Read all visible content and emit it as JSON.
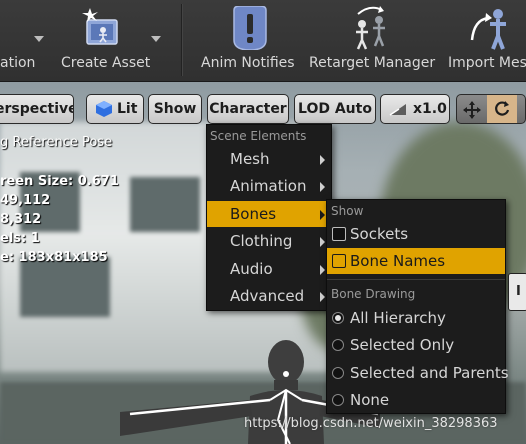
{
  "toolbar": {
    "items": [
      {
        "label": "ation",
        "icon": "animation-icon",
        "has_dropdown": true
      },
      {
        "label": "Create Asset",
        "icon": "create-asset-icon",
        "has_dropdown": true
      },
      {
        "label": "Anim Notifies",
        "icon": "anim-notifies-icon",
        "has_dropdown": false
      },
      {
        "label": "Retarget Manager",
        "icon": "retarget-manager-icon",
        "has_dropdown": false
      },
      {
        "label": "Import Mesh",
        "icon": "import-mesh-icon",
        "has_dropdown": false
      }
    ]
  },
  "viewport_toolbar": {
    "perspective": "erspective",
    "lit": "Lit",
    "show": "Show",
    "character": "Character",
    "lod": "LOD Auto",
    "speed": "x1.0",
    "icons": [
      "view-mode-icon",
      "translate-gizmo-icon",
      "rotate-gizmo-icon"
    ]
  },
  "stats": [
    "g Reference Pose",
    "reen Size: 0.671",
    "49,112",
    "8,312",
    "els: 1",
    "e: 183x81x185"
  ],
  "character_menu": {
    "header": "Scene Elements",
    "items": [
      {
        "label": "Mesh",
        "highlighted": false
      },
      {
        "label": "Animation",
        "highlighted": false
      },
      {
        "label": "Bones",
        "highlighted": true
      },
      {
        "label": "Clothing",
        "highlighted": false
      },
      {
        "label": "Audio",
        "highlighted": false
      },
      {
        "label": "Advanced",
        "highlighted": false
      }
    ]
  },
  "bones_menu": {
    "show_header": "Show",
    "show_items": [
      {
        "label": "Sockets",
        "checked": false,
        "highlighted": false
      },
      {
        "label": "Bone Names",
        "checked": false,
        "highlighted": true
      }
    ],
    "drawing_header": "Bone Drawing",
    "drawing_items": [
      {
        "label": "All Hierarchy",
        "selected": true
      },
      {
        "label": "Selected Only",
        "selected": false
      },
      {
        "label": "Selected and Parents",
        "selected": false
      },
      {
        "label": "None",
        "selected": false
      }
    ]
  },
  "tooltip_stub": "I",
  "watermark": "https://blog.csdn.net/weixin_38298363",
  "colors": {
    "highlight": "#e0a300",
    "menu_bg": "#1c1c1c",
    "toolbar_bg": "#333333"
  }
}
